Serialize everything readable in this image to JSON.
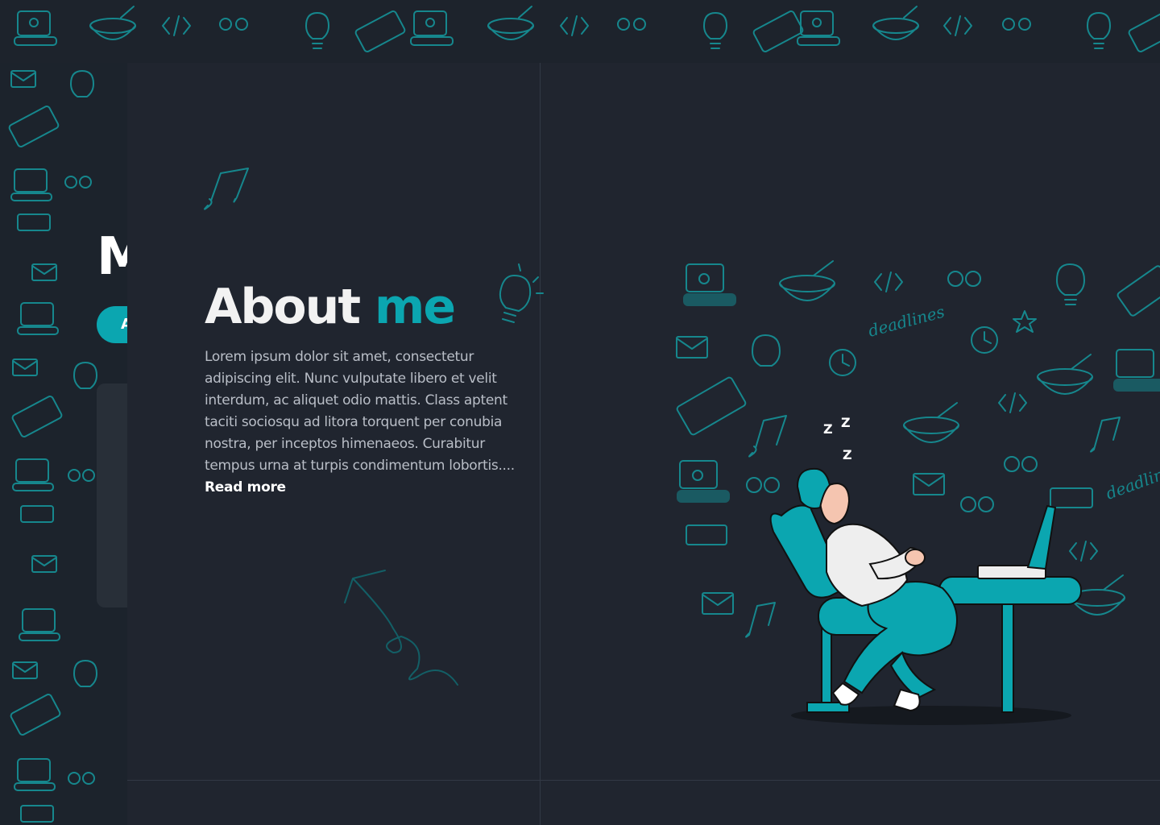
{
  "background": {
    "page_color": "#20252f",
    "pattern_color": "#16878d",
    "accent": "#0ba6b0"
  },
  "behind_panel": {
    "title_fragment": "M",
    "pill_fragment": "A"
  },
  "about": {
    "title_main": "About",
    "title_accent": "me",
    "body": "Lorem ipsum dolor sit amet, consectetur adipiscing elit. Nunc vulputate libero et velit interdum, ac aliquet odio mattis. Class aptent taciti sociosqu ad litora torquent per conubia nostra, per inceptos himenaeos. Curabitur tempus urna at turpis condimentum lobortis....",
    "read_more": "Read more"
  },
  "doodle_words": {
    "deadlines": "deadlines"
  },
  "illustration": {
    "subject": "person-sleeping-at-desk",
    "sleep_letters": [
      "Z",
      "Z",
      "Z"
    ],
    "colors": {
      "teal": "#0ba6b0",
      "skin": "#f5c5b0",
      "shirt": "#eeeeee",
      "hair": "#0ba6b0",
      "shadow": "#15191f"
    }
  }
}
